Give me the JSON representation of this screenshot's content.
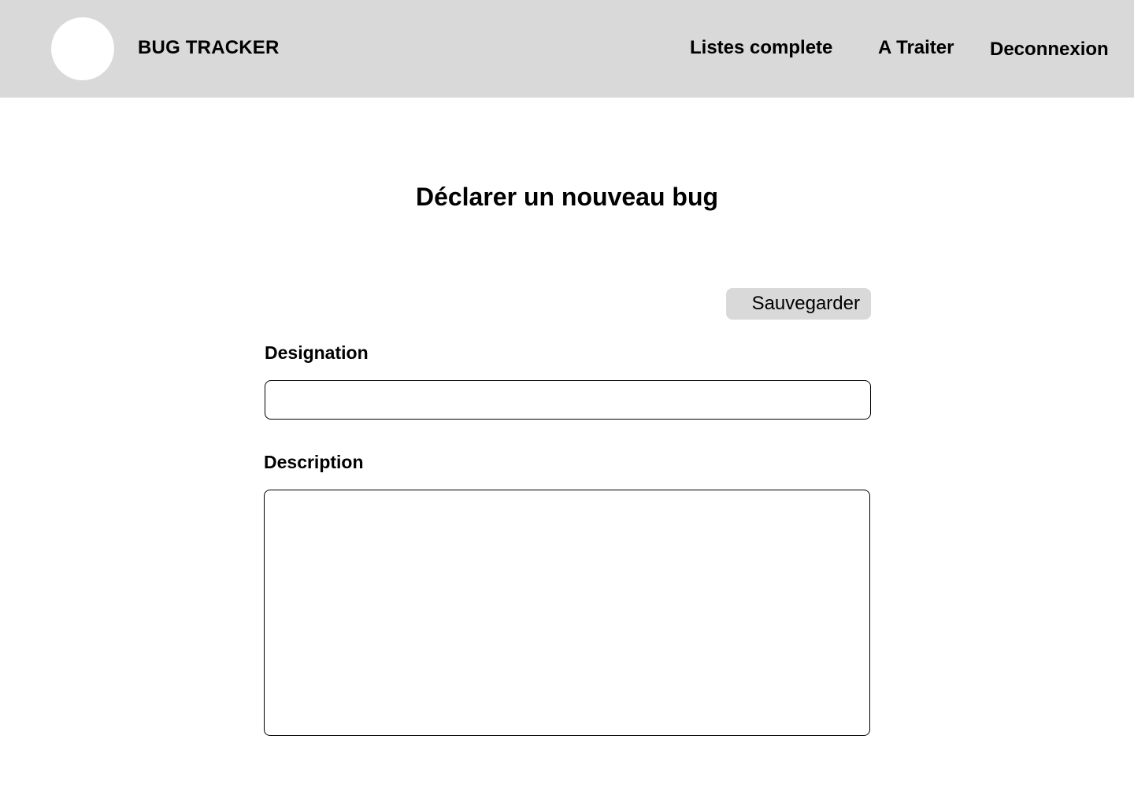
{
  "header": {
    "app_title": "BUG TRACKER",
    "logo_icon": "circle-logo-icon",
    "nav": {
      "full_list": "Listes complete",
      "to_process": "A Traiter",
      "logout": "Deconnexion"
    }
  },
  "main": {
    "title": "Déclarer un nouveau bug",
    "save_label": "Sauvegarder",
    "designation": {
      "label": "Designation",
      "value": ""
    },
    "description": {
      "label": "Description",
      "value": ""
    }
  },
  "colors": {
    "header_bg": "#d9d9d9",
    "button_bg": "#d9d9d9",
    "page_bg": "#ffffff",
    "text": "#000000"
  }
}
